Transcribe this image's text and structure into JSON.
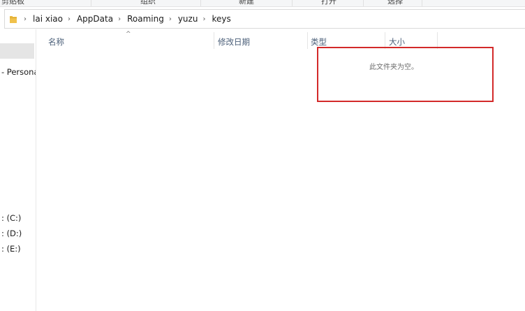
{
  "ribbon": {
    "groups": [
      "剪贴板",
      "组织",
      "新建",
      "打开",
      "选择"
    ]
  },
  "address_bar": {
    "folder_icon": "folder-icon",
    "crumbs": [
      "lai xiao",
      "AppData",
      "Roaming",
      "yuzu",
      "keys"
    ]
  },
  "nav_pane": {
    "items": [
      "- Persona",
      ": (C:)",
      ": (D:)",
      ": (E:)"
    ]
  },
  "columns": {
    "name": "名称",
    "date_modified": "修改日期",
    "type": "类型",
    "size": "大小",
    "sort_indicator": "^"
  },
  "content": {
    "empty_message": "此文件夹为空。"
  },
  "colors": {
    "highlight_box": "#d32a2a",
    "header_text": "#4c607a",
    "folder": "#f0c14b"
  }
}
